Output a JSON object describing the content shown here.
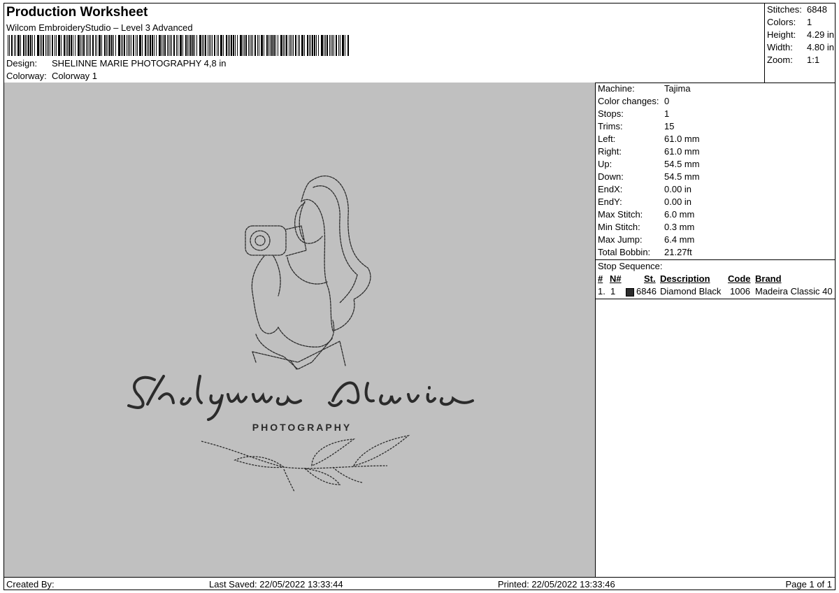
{
  "header": {
    "title": "Production Worksheet",
    "subtitle": "Wilcom EmbroideryStudio – Level 3 Advanced",
    "design_label": "Design:",
    "design_value": "SHELINNE MARIE PHOTOGRAPHY 4,8 in",
    "colorway_label": "Colorway:",
    "colorway_value": "Colorway 1"
  },
  "summary": [
    {
      "label": "Stitches:",
      "value": "6848"
    },
    {
      "label": "Colors:",
      "value": "1"
    },
    {
      "label": "Height:",
      "value": "4.29 in"
    },
    {
      "label": "Width:",
      "value": "4.80 in"
    },
    {
      "label": "Zoom:",
      "value": "1:1"
    }
  ],
  "machine_info": [
    {
      "label": "Machine:",
      "value": "Tajima"
    },
    {
      "label": "Color changes:",
      "value": "0"
    },
    {
      "label": "Stops:",
      "value": "1"
    },
    {
      "label": "Trims:",
      "value": "15"
    },
    {
      "label": "Left:",
      "value": "61.0 mm"
    },
    {
      "label": "Right:",
      "value": "61.0 mm"
    },
    {
      "label": "Up:",
      "value": "54.5 mm"
    },
    {
      "label": "Down:",
      "value": "54.5 mm"
    },
    {
      "label": "EndX:",
      "value": "0.00 in"
    },
    {
      "label": "EndY:",
      "value": "0.00 in"
    },
    {
      "label": "Max Stitch:",
      "value": "6.0 mm"
    },
    {
      "label": "Min Stitch:",
      "value": "0.3 mm"
    },
    {
      "label": "Max Jump:",
      "value": "6.4 mm"
    },
    {
      "label": "Total Bobbin:",
      "value": "21.27ft"
    }
  ],
  "stop_sequence": {
    "title": "Stop Sequence:",
    "headers": {
      "num": "#",
      "n": "N#",
      "st": "St.",
      "description": "Description",
      "code": "Code",
      "brand": "Brand"
    },
    "rows": [
      {
        "num": "1.",
        "n": "1",
        "swatch_color": "#2b2b2b",
        "st": "6846",
        "description": "Diamond Black",
        "code": "1006",
        "brand": "Madeira Classic 40"
      }
    ]
  },
  "design_preview": {
    "name_text": "Shelynne Marie",
    "tag_text": "PHOTOGRAPHY",
    "background_color": "#c0c0c0",
    "thread_color": "#2b2b2b"
  },
  "footer": {
    "created_by": "Created By:",
    "last_saved": "Last Saved: 22/05/2022 13:33:44",
    "printed": "Printed: 22/05/2022 13:33:46",
    "page": "Page 1 of 1"
  }
}
